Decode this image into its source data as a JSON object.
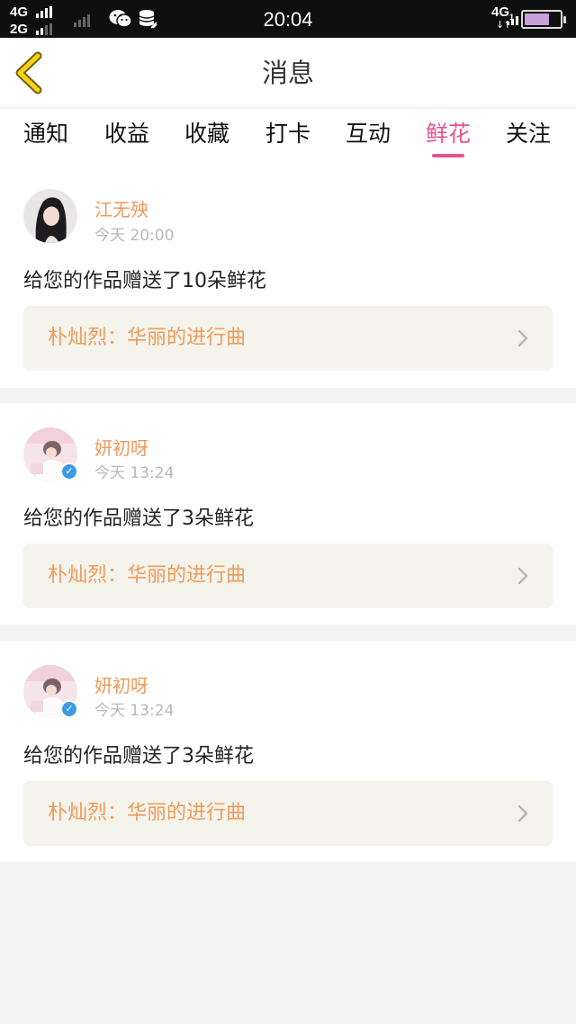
{
  "status_bar": {
    "network_1": "4G",
    "network_2": "2G",
    "time": "20:04",
    "network_right": "4G",
    "network_right_sub": "1",
    "arrows": "↓↑",
    "icons": [
      "wechat-icon",
      "database-icon",
      "battery-icon"
    ]
  },
  "header": {
    "title": "消息",
    "back_icon": "chevron-left-icon",
    "accent": "#f5c518"
  },
  "tabs": {
    "active_index": 5,
    "accent": "#e4558f",
    "items": [
      {
        "label": "通知"
      },
      {
        "label": "收益"
      },
      {
        "label": "收藏"
      },
      {
        "label": "打卡"
      },
      {
        "label": "互动"
      },
      {
        "label": "鲜花"
      },
      {
        "label": "关注"
      }
    ]
  },
  "messages": [
    {
      "user": "江无殃",
      "time": "今天 20:00",
      "text": "给您的作品赠送了10朵鲜花",
      "work": "朴灿烈：华丽的进行曲",
      "verified": false
    },
    {
      "user": "妍初呀",
      "time": "今天 13:24",
      "text": "给您的作品赠送了3朵鲜花",
      "work": "朴灿烈：华丽的进行曲",
      "verified": true
    },
    {
      "user": "妍初呀",
      "time": "今天 13:24",
      "text": "给您的作品赠送了3朵鲜花",
      "work": "朴灿烈：华丽的进行曲",
      "verified": true
    }
  ],
  "colors": {
    "name": "#f09a5a",
    "work_bg": "#f4f4ec",
    "page_bg": "#f4f4f4",
    "verified": "#3c9be4"
  }
}
